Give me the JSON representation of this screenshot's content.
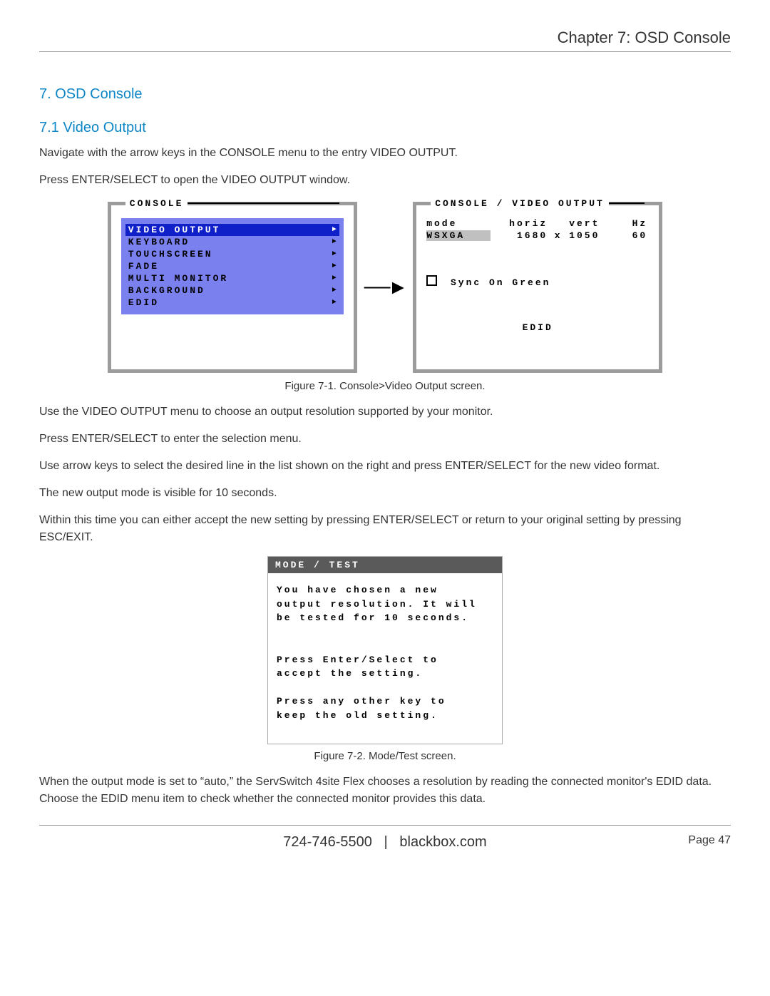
{
  "header": {
    "chapter_title": "Chapter 7: OSD Console"
  },
  "section": {
    "title": "7. OSD Console"
  },
  "subsection": {
    "title": "7.1 Video Output"
  },
  "paragraphs": {
    "p1": "Navigate with the arrow keys in the CONSOLE menu to the entry VIDEO OUTPUT.",
    "p2": "Press ENTER/SELECT to open the VIDEO OUTPUT window.",
    "p3": "Use the VIDEO OUTPUT menu to choose an output resolution supported by your monitor.",
    "p4": "Press ENTER/SELECT to enter the selection menu.",
    "p5": "Use arrow keys to select the desired line in the list shown on the right and press ENTER/SELECT for the new video format.",
    "p6": "The new output mode is visible for 10 seconds.",
    "p7": "Within this time you can either accept the new setting by pressing ENTER/SELECT or return to your original setting by pressing ESC/EXIT.",
    "p8": "When the output mode is set to “auto,” the ServSwitch 4site Flex chooses a resolution by reading the connected monitor's EDID data. Choose the EDID menu item to check whether the connected monitor provides this data."
  },
  "figure1": {
    "caption": "Figure 7-1. Console>Video Output screen.",
    "left_title": "CONSOLE",
    "right_title": "CONSOLE / VIDEO OUTPUT",
    "menu_items": [
      "VIDEO OUTPUT",
      "KEYBOARD",
      "TOUCHSCREEN",
      "FADE",
      "MULTI MONITOR",
      "BACKGROUND",
      "EDID"
    ],
    "vo_headers": {
      "mode": "mode",
      "horiz": "horiz",
      "vert": "vert",
      "hz": "Hz"
    },
    "vo_row": {
      "mode": "WSXGA",
      "horiz": "1680",
      "x": "x",
      "vert": "1050",
      "hz": "60"
    },
    "sync_label": "Sync On Green",
    "edid_label": "EDID"
  },
  "figure2": {
    "caption": "Figure 7-2. Mode/Test screen.",
    "title": "MODE / TEST",
    "body_lines": [
      "You have chosen a new",
      "output resolution. It will",
      "be tested for 10 seconds.",
      "",
      "",
      "Press Enter/Select to",
      "accept the setting.",
      "",
      "Press any other key to",
      "keep the old setting."
    ]
  },
  "footer": {
    "phone": "724-746-5500",
    "sep": "|",
    "site": "blackbox.com",
    "page_label": "Page 47"
  }
}
